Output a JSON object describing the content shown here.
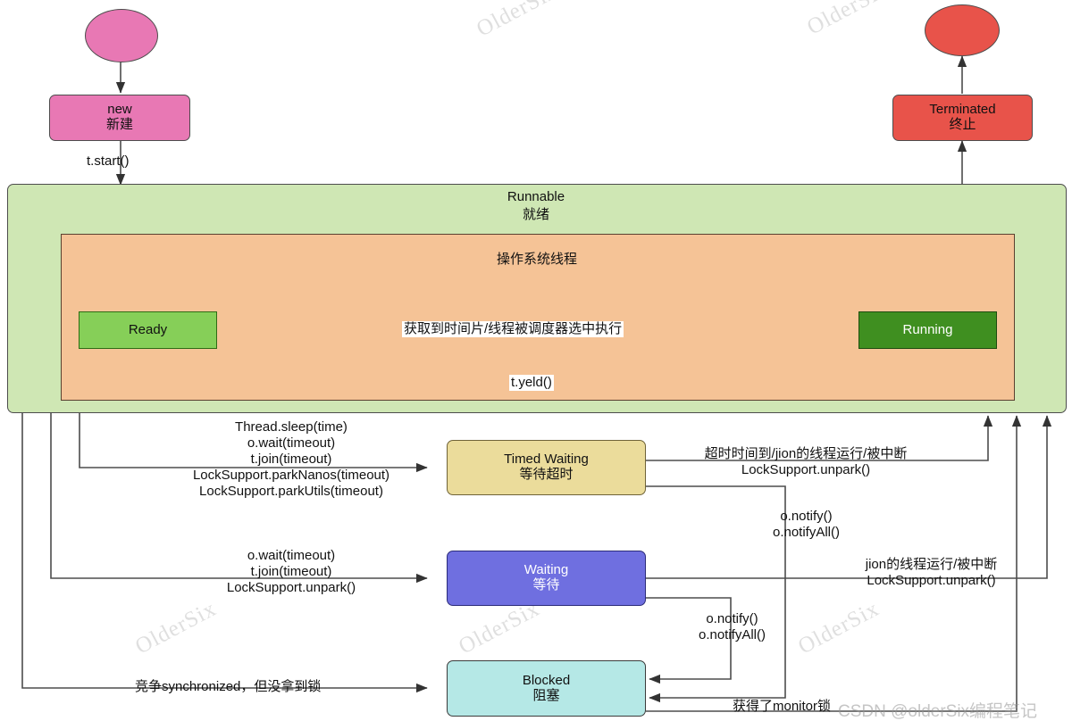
{
  "diagram": {
    "title": "Java Thread State Diagram",
    "watermark_text": "OlderSix",
    "watermark_credit": "CSDN @olderSix编程笔记"
  },
  "colors": {
    "start_node": "#e878b4",
    "new_box": "#e878b4",
    "end_node": "#e8534a",
    "terminated_box": "#e8534a",
    "runnable_container": "#cfe7b4",
    "os_thread_container": "#f5c396",
    "ready_box": "#86cf58",
    "running_box": "#3f8f20",
    "timed_waiting_box": "#ebdc9b",
    "waiting_box": "#6f6fe0",
    "blocked_box": "#b5e8e6",
    "stroke": "#4d4d4d",
    "text": "#111111"
  },
  "nodes": {
    "start": {
      "label": "",
      "shape": "ellipse"
    },
    "new": {
      "en": "new",
      "cn": "新建"
    },
    "terminated": {
      "en": "Terminated",
      "cn": "终止"
    },
    "end": {
      "label": "",
      "shape": "ellipse"
    },
    "runnable": {
      "en": "Runnable",
      "cn": "就绪"
    },
    "os_thread": {
      "cn": "操作系统线程"
    },
    "ready": {
      "en": "Ready",
      "cn": ""
    },
    "running": {
      "en": "Running",
      "cn": ""
    },
    "timed_waiting": {
      "en": "Timed Waiting",
      "cn": "等待超时"
    },
    "waiting": {
      "en": "Waiting",
      "cn": "等待"
    },
    "blocked": {
      "en": "Blocked",
      "cn": "阻塞"
    }
  },
  "edges": {
    "start_to_new": "",
    "new_to_runnable": "t.start()",
    "ready_to_running": "获取到时间片/线程被调度器选中执行",
    "running_to_ready": "t.yeld()",
    "runnable_to_timed_waiting": "Thread.sleep(time)\no.wait(timeout)\nt.join(timeout)\nLockSupport.parkNanos(timeout)\nLockSupport.parkUtils(timeout)",
    "runnable_to_timed_waiting_lines": [
      "Thread.sleep(time)",
      "o.wait(timeout)",
      "t.join(timeout)",
      "LockSupport.parkNanos(timeout)",
      "LockSupport.parkUtils(timeout)"
    ],
    "timed_waiting_to_runnable_lines": [
      "超时时间到/jion的线程运行/被中断",
      "LockSupport.unpark()"
    ],
    "timed_waiting_to_blocked_lines": [
      "o.notify()",
      "o.notifyAll()"
    ],
    "runnable_to_waiting_lines": [
      "o.wait(timeout)",
      "t.join(timeout)",
      "LockSupport.unpark()"
    ],
    "waiting_to_runnable_lines": [
      "jion的线程运行/被中断",
      "LockSupport.unpark()"
    ],
    "waiting_to_blocked_lines": [
      "o.notify()",
      "o.notifyAll()"
    ],
    "runnable_to_blocked": "竞争synchronized，但没拿到锁",
    "blocked_to_runnable": "获得了monitor锁"
  }
}
